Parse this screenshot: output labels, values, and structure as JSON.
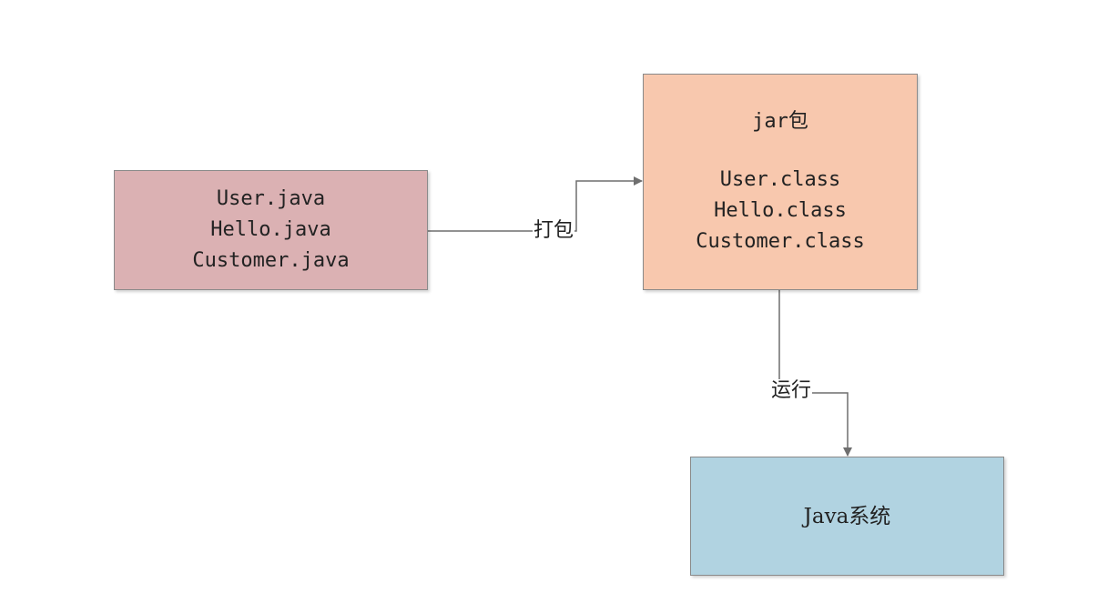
{
  "nodes": {
    "source": {
      "lines": [
        "User.java",
        "Hello.java",
        "Customer.java"
      ],
      "color": "#dbb1b3"
    },
    "jar": {
      "title": "jar包",
      "lines": [
        "User.class",
        "Hello.class",
        "Customer.class"
      ],
      "color": "#f8c8ae"
    },
    "system": {
      "label": "Java系统",
      "color": "#b1d3e1"
    }
  },
  "edges": {
    "pack": {
      "label": "打包"
    },
    "run": {
      "label": "运行"
    }
  },
  "connector_color": "#6f6f6f"
}
